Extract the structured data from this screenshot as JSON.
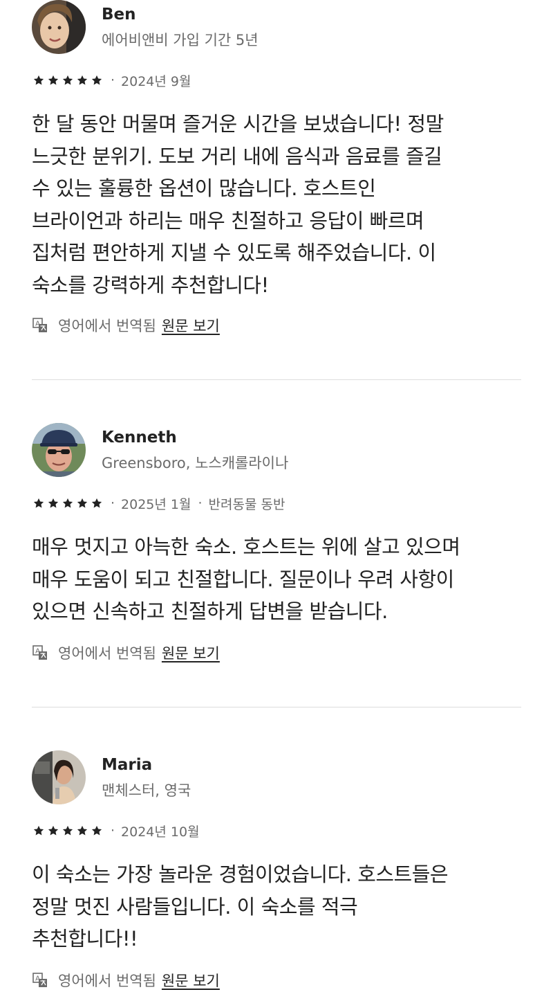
{
  "reviews": [
    {
      "name": "Ben",
      "subtitle": "에어비앤비 가입 기간 5년",
      "rating": 5,
      "date": "2024년 9월",
      "tag": "",
      "body_lines": [
        "한 달 동안 머물며 즐거운 시간을 보냈습니다! 정말",
        "느긋한 분위기. 도보 거리 내에 음식과 음료를 즐길",
        "수 있는 훌륭한 옵션이 많습니다. 호스트인",
        "브라이언과 하리는 매우 친절하고 응답이 빠르며",
        "집처럼 편안하게 지낼 수 있도록 해주었습니다. 이",
        "숙소를 강력하게 추천합니다!"
      ],
      "translated_note": "영어에서 번역됨",
      "view_original": "원문 보기"
    },
    {
      "name": "Kenneth",
      "subtitle": "Greensboro, 노스캐롤라이나",
      "rating": 5,
      "date": "2025년 1월",
      "tag": "반려동물 동반",
      "body_lines": [
        "매우 멋지고 아늑한 숙소. 호스트는 위에 살고 있으며",
        "매우 도움이 되고 친절합니다. 질문이나 우려 사항이",
        "있으면 신속하고 친절하게 답변을 받습니다."
      ],
      "translated_note": "영어에서 번역됨",
      "view_original": "원문 보기"
    },
    {
      "name": "Maria",
      "subtitle": "맨체스터, 영국",
      "rating": 5,
      "date": "2024년 10월",
      "tag": "",
      "body_lines": [
        "이 숙소는 가장 놀라운 경험이었습니다. 호스트들은",
        "정말 멋진 사람들입니다. 이 숙소를 적극",
        "추천합니다!!"
      ],
      "translated_note": "영어에서 번역됨",
      "view_original": "원문 보기"
    }
  ],
  "separator": "·",
  "colors": {
    "text_primary": "#222222",
    "text_secondary": "#6a6a6a",
    "divider": "#dddddd",
    "star": "#222222"
  }
}
